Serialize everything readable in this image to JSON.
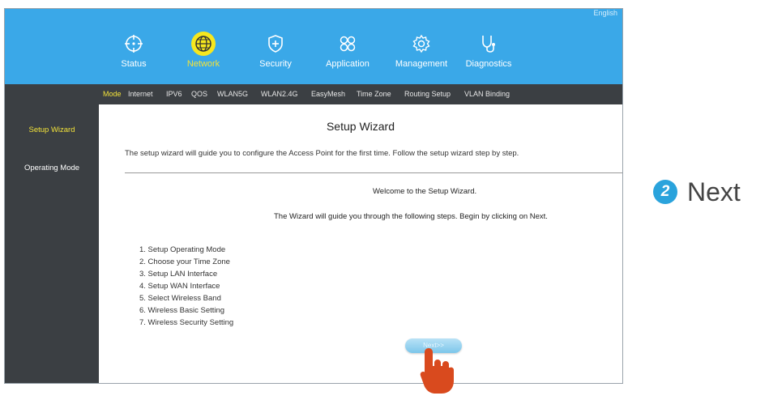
{
  "header": {
    "language": "English",
    "nav": [
      {
        "label": "Status",
        "icon": "crosshair-icon"
      },
      {
        "label": "Network",
        "icon": "globe-icon"
      },
      {
        "label": "Security",
        "icon": "shield-plus-icon"
      },
      {
        "label": "Application",
        "icon": "grid-icon"
      },
      {
        "label": "Management",
        "icon": "gear-icon"
      },
      {
        "label": "Diagnostics",
        "icon": "stethoscope-icon"
      }
    ],
    "active_nav": "Network"
  },
  "subnav": {
    "items": [
      "Mode",
      "Internet",
      "IPV6",
      "QOS",
      "WLAN5G",
      "WLAN2.4G",
      "EasyMesh",
      "Time Zone",
      "Routing Setup",
      "VLAN Binding"
    ],
    "active": "Mode"
  },
  "sidebar": {
    "items": [
      "Setup Wizard",
      "Operating Mode"
    ],
    "active": "Setup Wizard"
  },
  "main": {
    "title": "Setup Wizard",
    "intro": "The setup wizard will guide you to configure the Access Point for the first time. Follow the setup wizard step by step.",
    "welcome": "Welcome to the Setup Wizard.",
    "guide": "The Wizard will guide you through the following steps. Begin by clicking on Next.",
    "steps": [
      "1.  Setup Operating Mode",
      "2.  Choose your Time Zone",
      "3.  Setup LAN Interface",
      "4.  Setup WAN Interface",
      "5.  Select Wireless Band",
      "6.  Wireless Basic Setting",
      "7.  Wireless Security Setting"
    ],
    "next_label": "Next>>"
  },
  "callout": {
    "number": "2",
    "text": "Next"
  },
  "colors": {
    "header_bg": "#3aa8e8",
    "dark_bg": "#3b3f43",
    "active_text": "#f2e23a",
    "badge": "#2aa3dc",
    "hand": "#d94a1e"
  }
}
